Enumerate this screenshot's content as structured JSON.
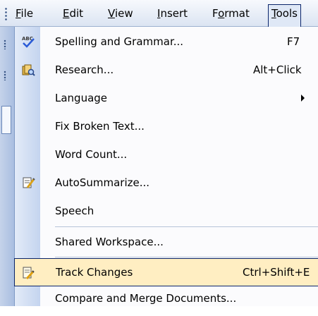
{
  "menubar": {
    "items": [
      {
        "label": "File",
        "mnemonic": "F"
      },
      {
        "label": "Edit",
        "mnemonic": "E"
      },
      {
        "label": "View",
        "mnemonic": "V"
      },
      {
        "label": "Insert",
        "mnemonic": "I"
      },
      {
        "label": "Format",
        "mnemonic": "o"
      },
      {
        "label": "Tools",
        "mnemonic": "T"
      }
    ],
    "active_item": "Tools"
  },
  "tools_menu": {
    "items": [
      {
        "label": "Spelling and Grammar...",
        "shortcut": "F7",
        "icon": "spelling-abc-check-icon"
      },
      {
        "label": "Research...",
        "shortcut": "Alt+Click",
        "icon": "research-book-icon"
      },
      {
        "label": "Language",
        "shortcut": "",
        "submenu": true
      },
      {
        "label": "Fix Broken Text...",
        "shortcut": ""
      },
      {
        "label": "Word Count...",
        "shortcut": ""
      },
      {
        "label": "AutoSummarize...",
        "shortcut": "",
        "icon": "autosummarize-icon"
      },
      {
        "label": "Speech",
        "shortcut": ""
      },
      {
        "label": "Shared Workspace...",
        "shortcut": ""
      },
      {
        "label": "Track Changes",
        "shortcut": "Ctrl+Shift+E",
        "icon": "track-changes-icon",
        "selected": true
      },
      {
        "label": "Compare and Merge Documents...",
        "shortcut": ""
      }
    ]
  },
  "colors": {
    "menubar_bg": "#dbe4f2",
    "gutter": "#c4d4ef",
    "highlight": "#ffeec2",
    "highlight_border": "#0a246a"
  }
}
